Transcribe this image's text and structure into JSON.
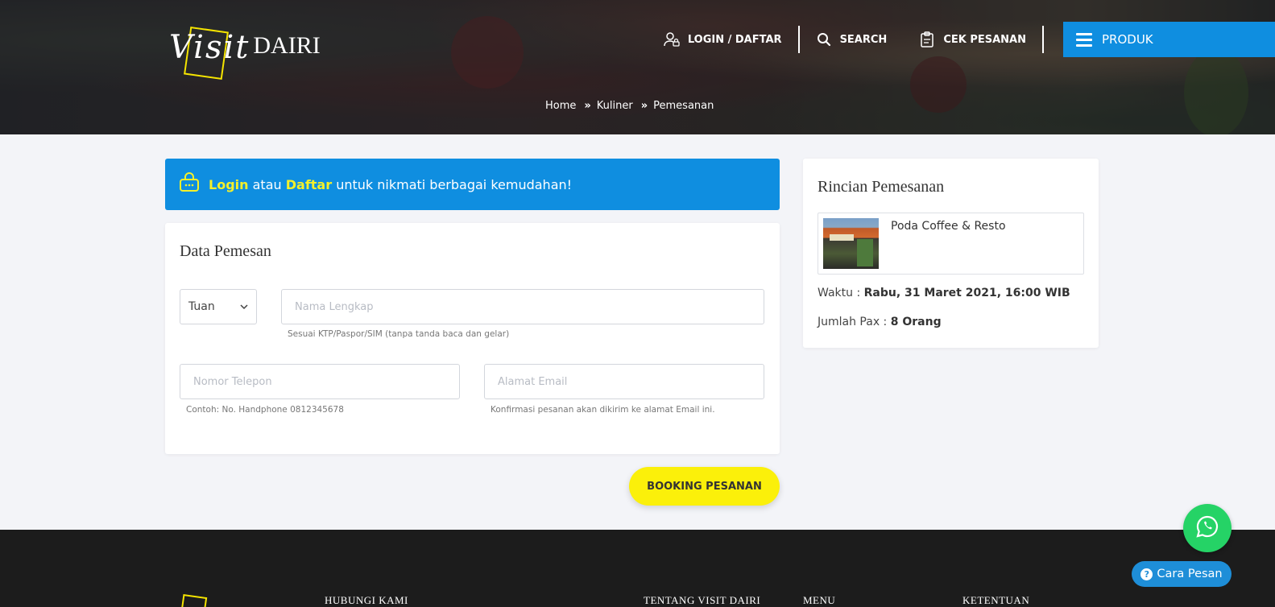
{
  "brand": {
    "script": "Visit",
    "word": "DAIRI"
  },
  "nav": {
    "login": "LOGIN / DAFTAR",
    "search": "SEARCH",
    "cek": "CEK PESANAN",
    "produk": "PRODUK"
  },
  "breadcrumb": {
    "items": [
      "Home",
      "Kuliner",
      "Pemesanan"
    ],
    "separator": "»"
  },
  "banner": {
    "login": "Login",
    "or": "atau",
    "daftar": "Daftar",
    "rest": "untuk nikmati berbagai kemudahan!"
  },
  "form": {
    "title": "Data Pemesan",
    "title_select": {
      "value": "Tuan"
    },
    "name": {
      "placeholder": "Nama Lengkap",
      "hint": "Sesuai KTP/Paspor/SIM (tanpa tanda baca dan gelar)"
    },
    "phone": {
      "placeholder": "Nomor Telepon",
      "hint": "Contoh: No. Handphone 0812345678"
    },
    "email": {
      "placeholder": "Alamat Email",
      "hint": "Konfirmasi pesanan akan dikirim ke alamat Email ini."
    },
    "submit": "BOOKING PESANAN"
  },
  "summary": {
    "title": "Rincian Pemesanan",
    "item_name": "Poda Coffee & Resto",
    "time_label": "Waktu :",
    "time_value": "Rabu, 31 Maret 2021, 16:00 WIB",
    "pax_label": "Jumlah Pax :",
    "pax_value": "8 Orang"
  },
  "footer": {
    "hubungi": "HUBUNGI KAMI",
    "tentang": "TENTANG VISIT DAIRI",
    "menu": "MENU",
    "ketentuan": "KETENTUAN"
  },
  "floating": {
    "cara_pesan": "Cara Pesan"
  },
  "colors": {
    "primary": "#0f8ee0",
    "accent_yellow": "#fbf00a",
    "whatsapp": "#25d366",
    "footer": "#1c1c1c"
  }
}
